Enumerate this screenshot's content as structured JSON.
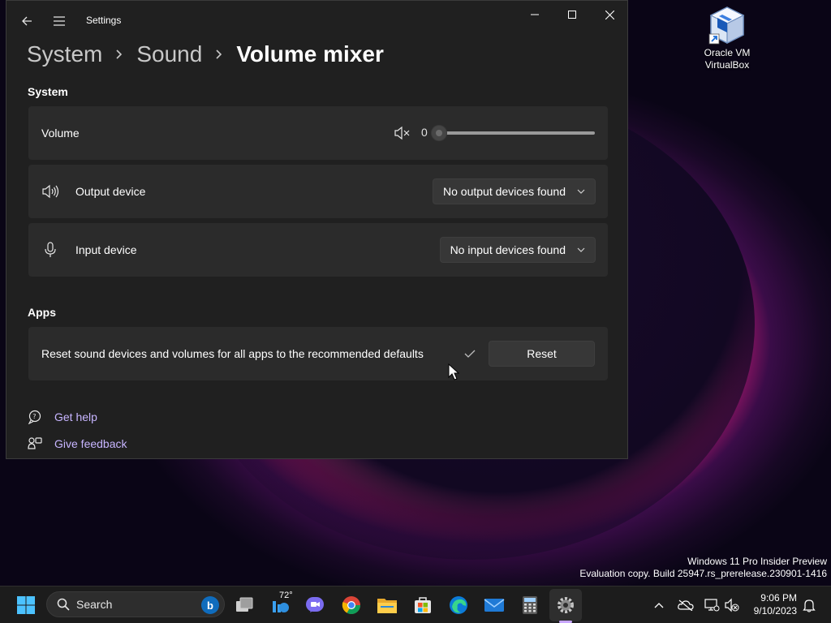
{
  "window": {
    "title": "Settings",
    "breadcrumb": [
      "System",
      "Sound",
      "Volume mixer"
    ]
  },
  "system_section": {
    "title": "System",
    "volume": {
      "label": "Volume",
      "value": "0",
      "level": 0
    },
    "output_device": {
      "label": "Output device",
      "selected": "No output devices found"
    },
    "input_device": {
      "label": "Input device",
      "selected": "No input devices found"
    }
  },
  "apps_section": {
    "title": "Apps",
    "reset": {
      "label": "Reset sound devices and volumes for all apps to the recommended defaults",
      "button_label": "Reset"
    }
  },
  "links": {
    "get_help": "Get help",
    "give_feedback": "Give feedback"
  },
  "desktop": {
    "icon_label_line1": "Oracle VM",
    "icon_label_line2": "VirtualBox",
    "watermark_line1": "Windows 11 Pro Insider Preview",
    "watermark_line2": "Evaluation copy. Build 25947.rs_prerelease.230901-1416"
  },
  "taskbar": {
    "search_placeholder": "Search",
    "weather_temp": "72°",
    "time": "9:06 PM",
    "date": "9/10/2023",
    "apps": [
      "task-view",
      "widgets-weather",
      "teams-chat",
      "chrome",
      "file-explorer",
      "microsoft-store",
      "edge",
      "mail",
      "calculator",
      "settings"
    ]
  },
  "colors": {
    "window_bg": "#202020",
    "card_bg": "#2b2b2b",
    "link_color": "#c7b5ff",
    "accent": "#4cc2ff"
  }
}
